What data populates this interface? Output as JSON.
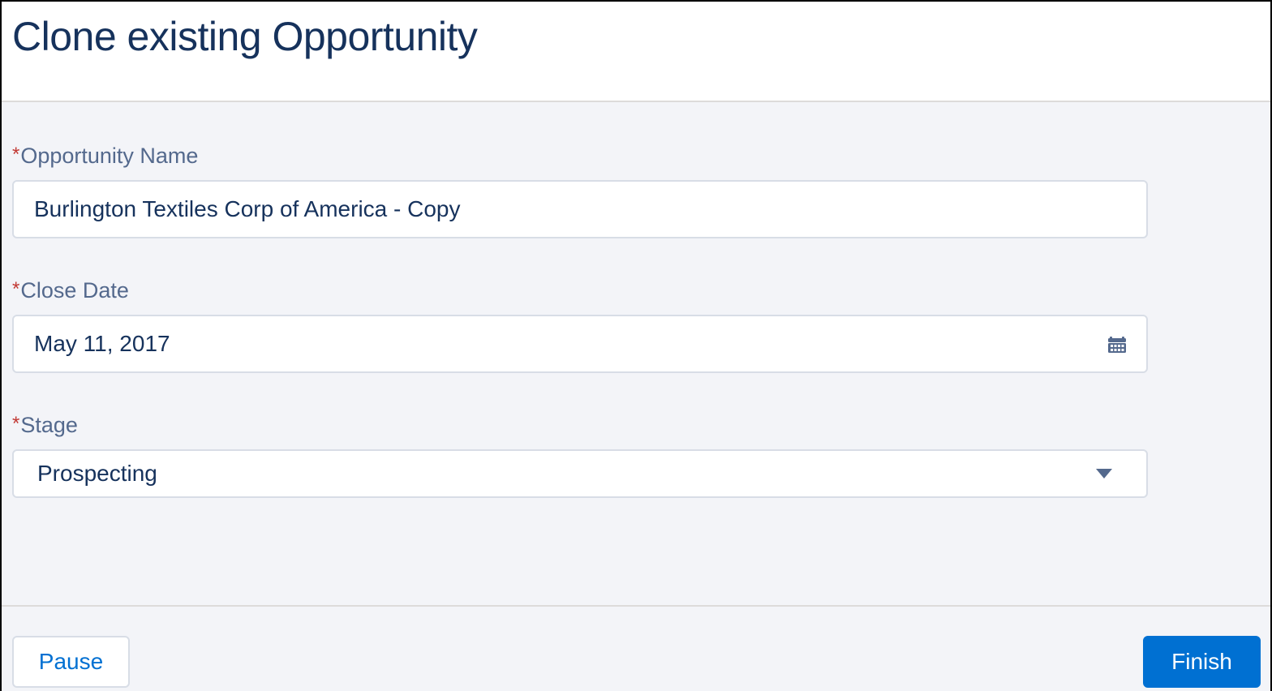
{
  "header": {
    "title": "Clone existing Opportunity"
  },
  "form": {
    "required_marker": "*",
    "opportunity_name": {
      "label": "Opportunity Name",
      "value": "Burlington Textiles Corp of America - Copy"
    },
    "close_date": {
      "label": "Close Date",
      "value": "May 11, 2017",
      "icon": "calendar-icon"
    },
    "stage": {
      "label": "Stage",
      "value": "Prospecting",
      "icon": "chevron-down-icon"
    }
  },
  "footer": {
    "pause_label": "Pause",
    "finish_label": "Finish"
  },
  "colors": {
    "title": "#16325c",
    "label": "#54698d",
    "required": "#c23934",
    "brand": "#0070d2",
    "background": "#f3f4f8"
  }
}
